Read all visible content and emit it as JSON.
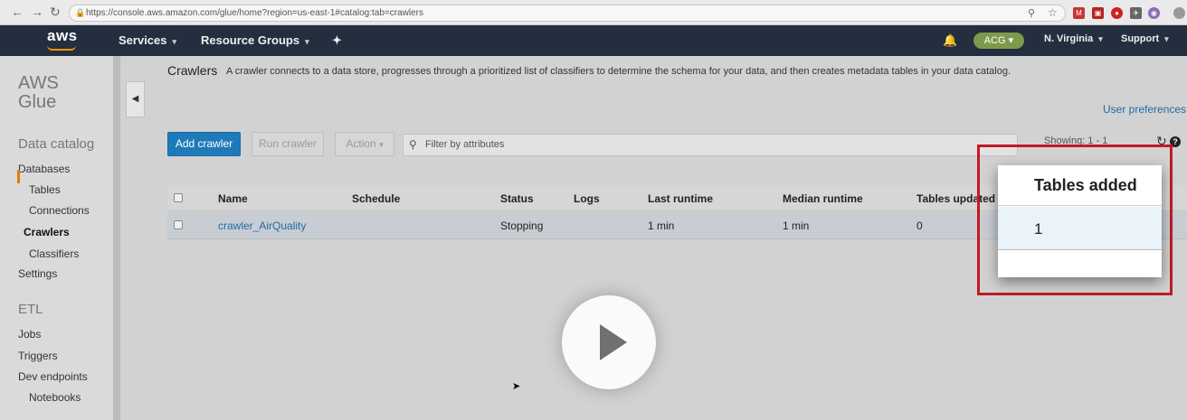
{
  "browser": {
    "url": "https://console.aws.amazon.com/glue/home?region=us-east-1#catalog:tab=crawlers"
  },
  "header": {
    "logo": "aws",
    "services": "Services",
    "resource_groups": "Resource Groups",
    "account_badge": "ACG",
    "region": "N. Virginia",
    "support": "Support"
  },
  "sidebar": {
    "service": "AWS Glue",
    "data_catalog_title": "Data catalog",
    "items": [
      "Databases",
      "Tables",
      "Connections",
      "Crawlers",
      "Classifiers",
      "Settings"
    ],
    "etl_title": "ETL",
    "etl_items": [
      "Jobs",
      "Triggers",
      "Dev endpoints",
      "Notebooks"
    ]
  },
  "main": {
    "title": "Crawlers",
    "description": "A crawler connects to a data store, progresses through a prioritized list of classifiers to determine the schema for your data, and then creates metadata tables in your data catalog.",
    "user_preferences": "User preferences",
    "add_crawler": "Add crawler",
    "run_crawler": "Run crawler",
    "action": "Action",
    "filter_placeholder": "Filter by attributes",
    "showing": "Showing: 1 - 1"
  },
  "table": {
    "columns": [
      "Name",
      "Schedule",
      "Status",
      "Logs",
      "Last runtime",
      "Median runtime",
      "Tables updated"
    ],
    "rows": [
      {
        "name": "crawler_AirQuality",
        "schedule": "",
        "status": "Stopping",
        "logs": "",
        "last_runtime": "1 min",
        "median_runtime": "1 min",
        "tables_updated": "0"
      }
    ]
  },
  "highlight": {
    "header": "Tables added",
    "value": "1"
  },
  "colors": {
    "aws_header": "#232f3e",
    "primary_button": "#1f7ab9",
    "link": "#1f6ba6",
    "highlight_border": "#c11b22",
    "active_marker": "#e07b00"
  }
}
